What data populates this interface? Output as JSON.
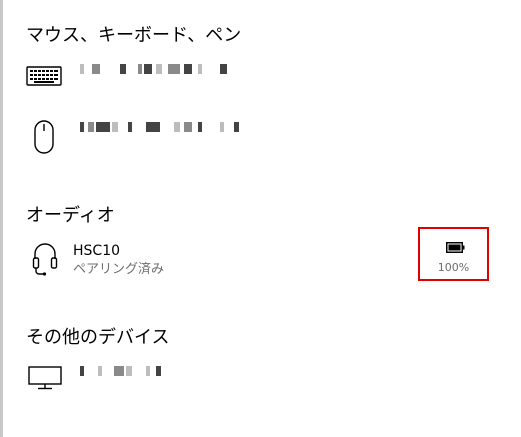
{
  "sections": {
    "input": {
      "title": "マウス、キーボード、ペン",
      "devices": [
        {
          "icon": "keyboard-icon",
          "name_redacted": true
        },
        {
          "icon": "mouse-icon",
          "name_redacted": true
        }
      ]
    },
    "audio": {
      "title": "オーディオ",
      "devices": [
        {
          "icon": "headset-icon",
          "name": "HSC10",
          "status": "ペアリング済み",
          "battery": {
            "icon": "battery-full-icon",
            "level_text": "100%",
            "level": 100
          }
        }
      ]
    },
    "other": {
      "title": "その他のデバイス",
      "devices": [
        {
          "icon": "monitor-icon",
          "name_redacted": true
        }
      ]
    }
  },
  "colors": {
    "highlight_border": "#e00000",
    "secondary_text": "#6d6d6d"
  }
}
